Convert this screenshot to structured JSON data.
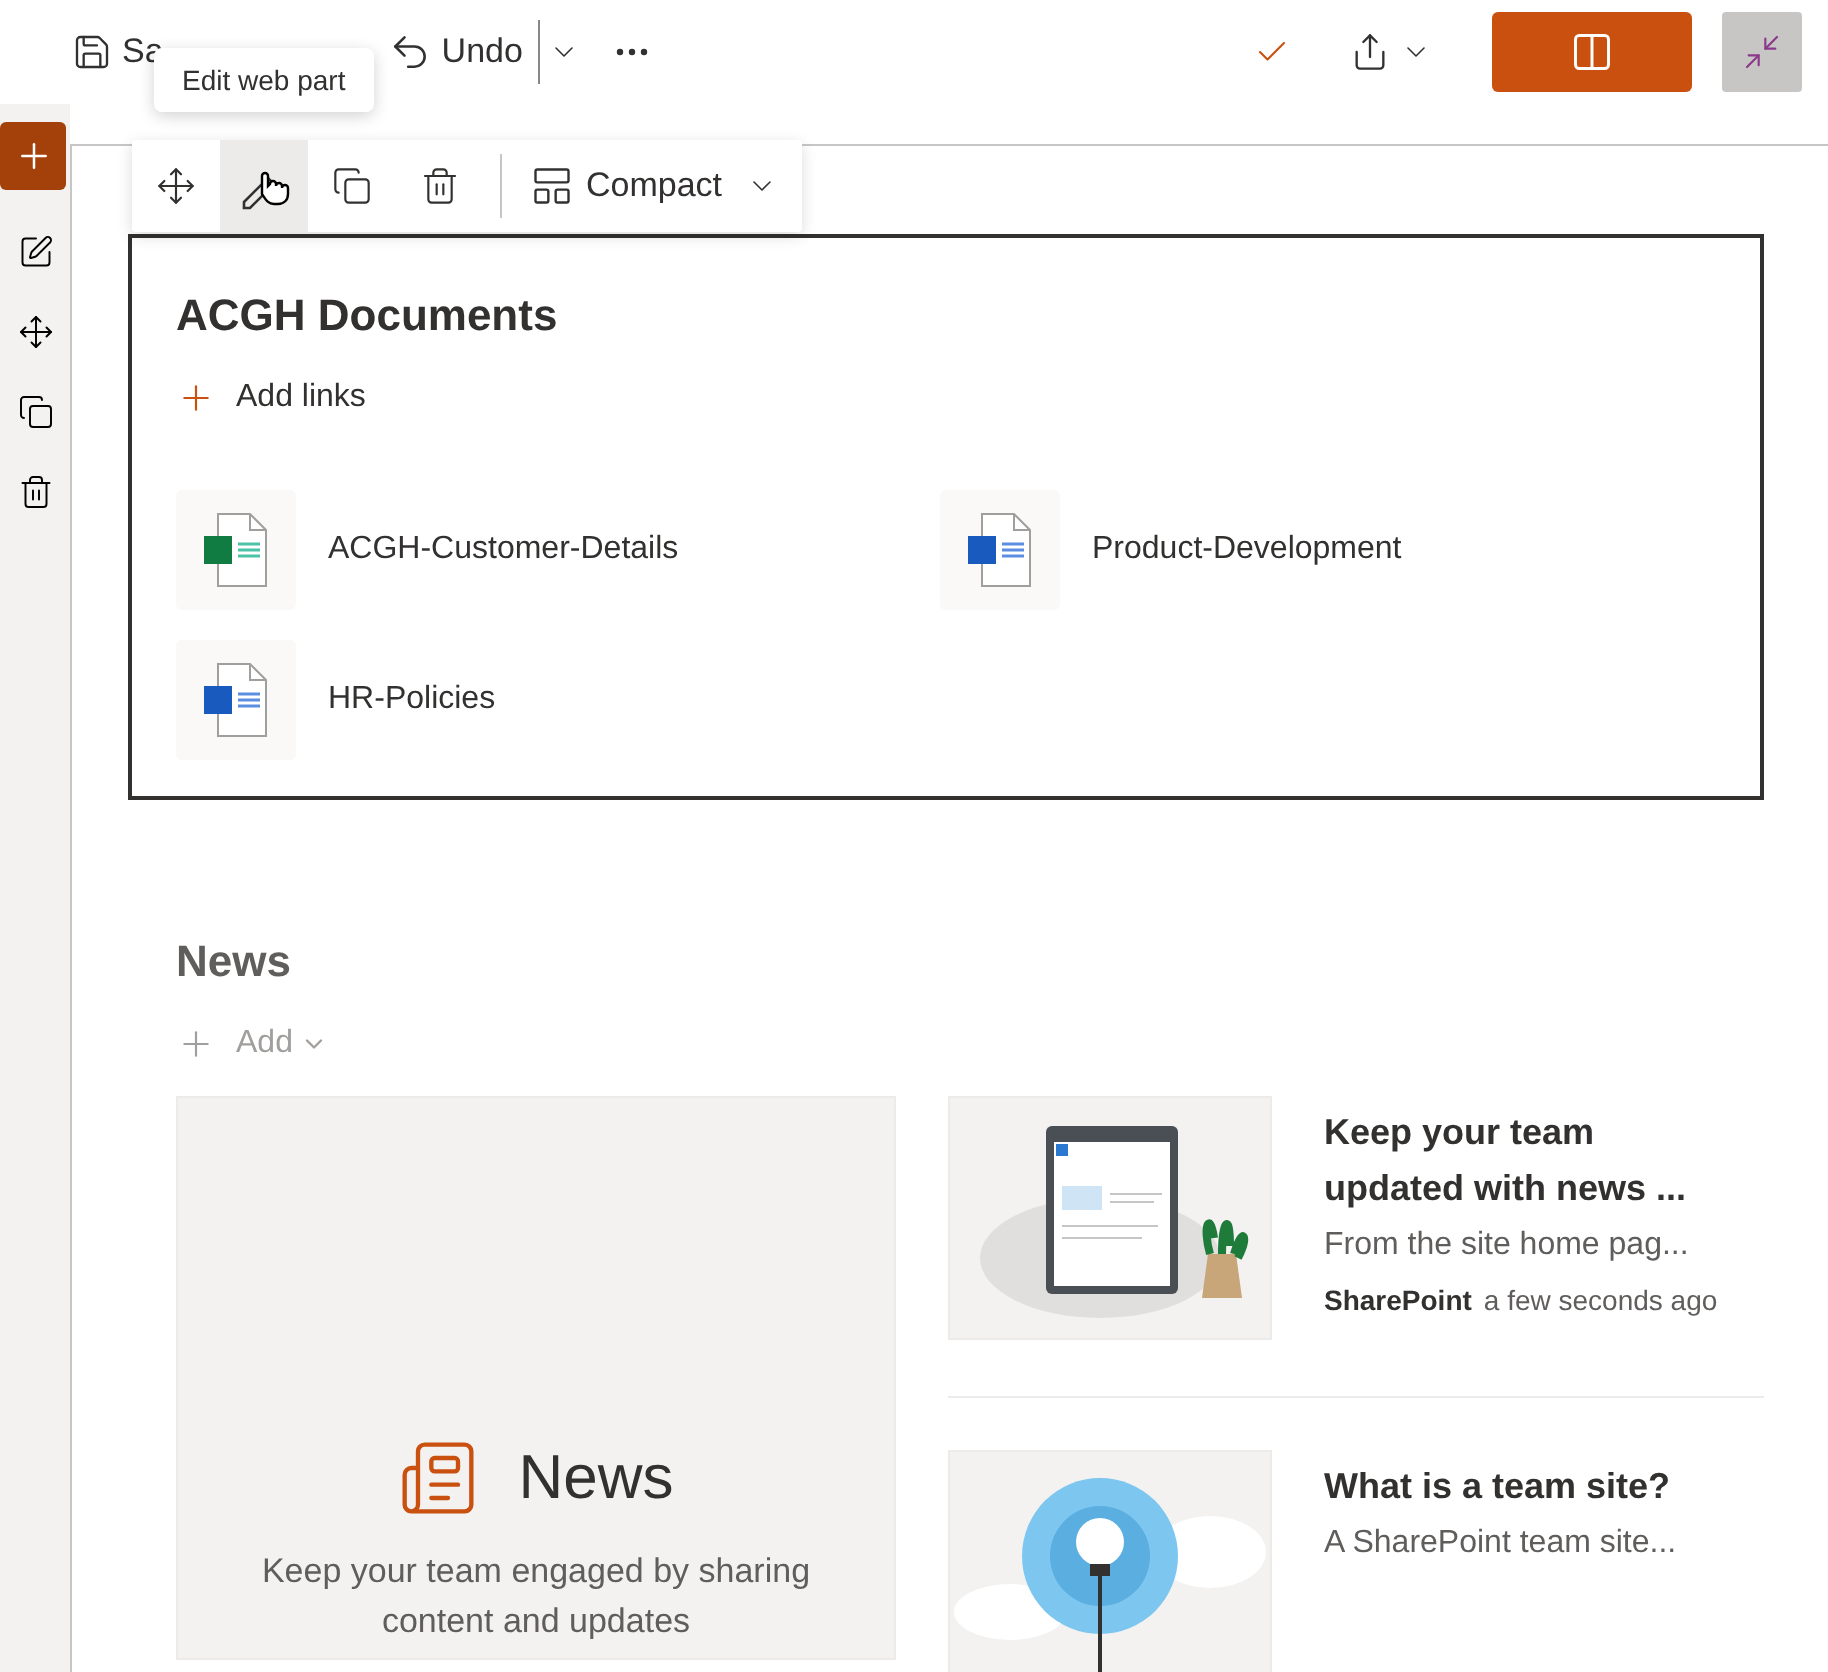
{
  "command_bar": {
    "save_label": "Sa",
    "undo_label": "Undo"
  },
  "tooltip": "Edit web part",
  "web_part_toolbar": {
    "tools": [
      {
        "kind": "move",
        "highlighted": false
      },
      {
        "kind": "edit",
        "highlighted": true
      },
      {
        "kind": "duplicate",
        "highlighted": false
      },
      {
        "kind": "delete",
        "highlighted": false
      }
    ],
    "layout_label": "Compact"
  },
  "documents": {
    "title": "ACGH Documents",
    "add_label": "Add links",
    "files": [
      {
        "name": "ACGH-Customer-Details",
        "kind": "excel"
      },
      {
        "name": "Product-Development",
        "kind": "word"
      },
      {
        "name": "HR-Policies",
        "kind": "word"
      }
    ]
  },
  "news": {
    "title": "News",
    "add_label": "Add",
    "placeholder": {
      "title": "News",
      "text": "Keep your team engaged by sharing content and updates"
    },
    "items": [
      {
        "kind": "tablet",
        "title": "Keep your team updated with news ...",
        "description": "From the site home pag...",
        "author": "SharePoint",
        "time": "a few seconds ago"
      },
      {
        "kind": "bulb",
        "title": "What is a team site?",
        "description": "A SharePoint team site..."
      }
    ]
  }
}
